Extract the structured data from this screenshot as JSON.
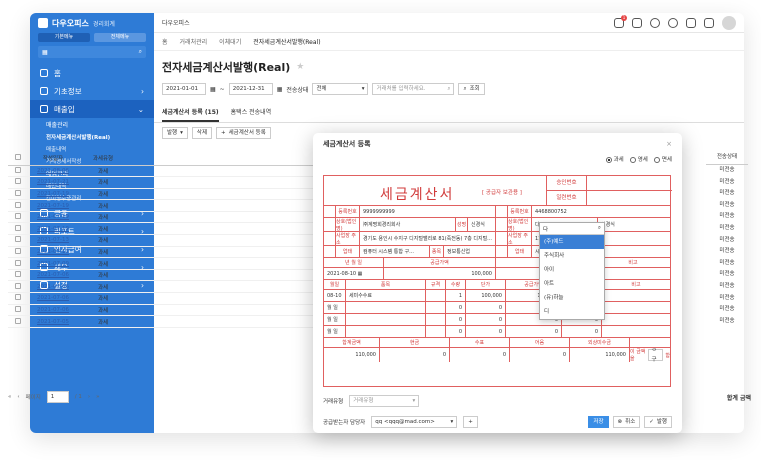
{
  "app": {
    "name": "다우오피스",
    "sub": "경리회계",
    "brand_color": "#2e7bd6"
  },
  "sidebar": {
    "toggle": [
      "기본메뉴",
      "전체메뉴"
    ],
    "search_label": "검색",
    "items": [
      {
        "label": "홈",
        "icon": "home-icon"
      },
      {
        "label": "기초정보",
        "icon": "info-icon"
      },
      {
        "label": "매출입",
        "icon": "menu-icon"
      }
    ],
    "subs": [
      {
        "label": "매출관리",
        "type": "h"
      },
      {
        "label": "전자세금계산서발행(Real)",
        "type": "b"
      },
      {
        "label": "매출내역",
        "type": ""
      },
      {
        "label": "거래명세서작성",
        "type": ""
      },
      {
        "label": "매입관리",
        "type": "h"
      },
      {
        "label": "매입내역",
        "type": ""
      },
      {
        "label": "간이영수증관리",
        "type": ""
      }
    ],
    "items2": [
      {
        "label": "금융",
        "icon": "bank-icon"
      },
      {
        "label": "리포트",
        "icon": "report-icon"
      },
      {
        "label": "인사급여",
        "icon": "person-icon"
      },
      {
        "label": "세무",
        "icon": "tax-icon"
      },
      {
        "label": "설정",
        "icon": "gear-icon"
      }
    ]
  },
  "topbar": {
    "title": "다우오피스",
    "badge": "1"
  },
  "tabs": [
    "홈",
    "거래처관리",
    "이체대기",
    "전자세금계산서발행(Real)"
  ],
  "page": {
    "title": "전자세금계산서발행(Real)"
  },
  "filters": {
    "date_from": "2021-01-01",
    "date_to": "2021-12-31",
    "status_label": "전송상태",
    "status_value": "전체",
    "keyword_placeholder": "거래처를 입력하세요.",
    "search": "조회"
  },
  "subtabs": [
    "세금계산서 등록 (15)",
    "홈택스 전송내역"
  ],
  "tools": {
    "add": "발행",
    "delete": "삭제",
    "register": "세금계산서 등록"
  },
  "grid": {
    "headers": [
      "작성일자",
      "과세유형"
    ],
    "rows": [
      [
        "2021-08-06",
        "과세"
      ],
      [
        "2021-07-21",
        "과세"
      ],
      [
        "2021-07-19",
        "과세"
      ],
      [
        "2021-07-19",
        "과세"
      ],
      [
        "2021-07-19",
        "과세"
      ],
      [
        "2021-07-19",
        "과세"
      ],
      [
        "2021-07-13",
        "과세"
      ],
      [
        "2021-07-12",
        "과세"
      ],
      [
        "2021-07-09",
        "과세"
      ],
      [
        "2021-07-06",
        "과세"
      ],
      [
        "2021-07-06",
        "과세"
      ],
      [
        "2021-07-06",
        "과세"
      ],
      [
        "2021-07-06",
        "과세"
      ],
      [
        "2021-07-05",
        "과세"
      ]
    ],
    "status_header": "전송상태",
    "status": "미전송",
    "total_label": "합계 금액"
  },
  "pager": {
    "page_label": "페이지",
    "page": "1",
    "of": "/ 1"
  },
  "modal": {
    "title": "세금계산서 등록",
    "radios": [
      "과세",
      "영세",
      "면세"
    ],
    "inv_title": "세금계산서",
    "inv_sub": "[ 공급자 보관용 ]",
    "approval_no": "승인번호",
    "serial_no": "일련번호",
    "supplier": {
      "reg_label": "등록번호",
      "reg": "9999999999",
      "name_label": "상호(법인명)",
      "name": "㈜계명회경리회사",
      "rep_label": "성명",
      "rep": "신경식",
      "addr_label": "사업장 주소",
      "addr": "경기도 용인시 수지구 디지털밸리로 81(죽전동) 7층 디지털...",
      "type_label": "업태",
      "type": "컴퓨터 시스템 통합 구...",
      "item_label": "종목",
      "item": "정보통신업"
    },
    "buyer": {
      "reg": "4468800752",
      "name_input": "다",
      "rep": "신경식",
      "addr": "1101호 서울시 노원구 중...",
      "type": "시스템 통합 구축"
    },
    "dates": {
      "write_label": "년 월 일",
      "write": "2021-08-10",
      "supply_label": "공급가액",
      "supply": "100,000",
      "tax_label": "세액",
      "note_label": "비고"
    },
    "item_headers": [
      "월일",
      "품목",
      "규격",
      "수량",
      "단가",
      "공급가액",
      "세액",
      "비고"
    ],
    "items": [
      {
        "date": "08-10",
        "name": "세미수수료",
        "qty": "1",
        "price": "100,000",
        "amt": "100,000",
        "tax": "10,000"
      },
      {
        "date": "월 일",
        "qty": "0",
        "price": "0",
        "amt": "0",
        "tax": "0"
      },
      {
        "date": "월 일",
        "qty": "0",
        "price": "0",
        "amt": "0",
        "tax": "0"
      },
      {
        "date": "월 일",
        "qty": "0",
        "price": "0",
        "amt": "0",
        "tax": "0"
      }
    ],
    "totals": {
      "headers": [
        "합계금액",
        "현금",
        "수표",
        "어음",
        "외상미수금"
      ],
      "values": [
        "110,000",
        "0",
        "0",
        "0",
        "110,000"
      ],
      "claim_label": "이 금액을",
      "claim": "청구",
      "suffix": "함"
    },
    "deal_type_label": "거래유형",
    "deal_type": "거래유형",
    "manager_label": "공급받는자 담당자",
    "manager": "qq <qqq@mad.com>",
    "buttons": {
      "save": "저장",
      "cancel": "취소",
      "issue": "발행"
    }
  },
  "dropdown": {
    "input": "다",
    "options": [
      "(주)예드",
      "주식회사",
      "아이",
      "아트",
      "(유)하늘",
      "디"
    ]
  }
}
